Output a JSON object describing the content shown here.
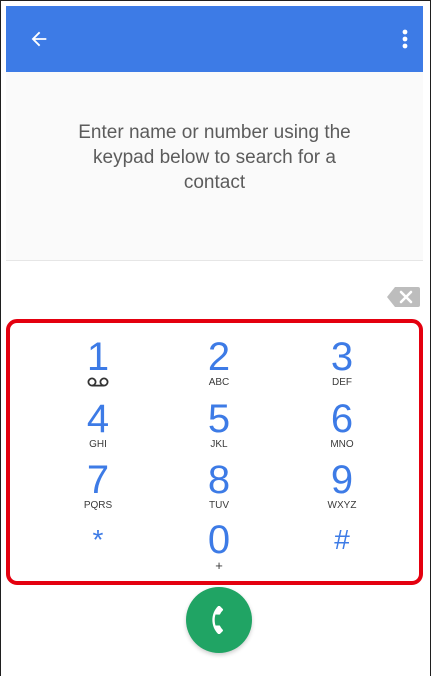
{
  "header": {
    "back_icon": "arrow-left-icon",
    "more_icon": "more-vert-icon",
    "color": "#3d7be6"
  },
  "hint": {
    "text": "Enter name or number using the keypad below to search for a contact"
  },
  "entry": {
    "backspace_icon": "backspace-icon"
  },
  "keypad": {
    "highlight_color": "#e4000f",
    "keys": [
      {
        "digit": "1",
        "letters": "",
        "icon": "voicemail-icon"
      },
      {
        "digit": "2",
        "letters": "ABC"
      },
      {
        "digit": "3",
        "letters": "DEF"
      },
      {
        "digit": "4",
        "letters": "GHI"
      },
      {
        "digit": "5",
        "letters": "JKL"
      },
      {
        "digit": "6",
        "letters": "MNO"
      },
      {
        "digit": "7",
        "letters": "PQRS"
      },
      {
        "digit": "8",
        "letters": "TUV"
      },
      {
        "digit": "9",
        "letters": "WXYZ"
      },
      {
        "digit": "*",
        "letters": ""
      },
      {
        "digit": "0",
        "letters": "+"
      },
      {
        "digit": "#",
        "letters": ""
      }
    ]
  },
  "call_button": {
    "icon": "phone-icon",
    "color": "#20a464"
  }
}
